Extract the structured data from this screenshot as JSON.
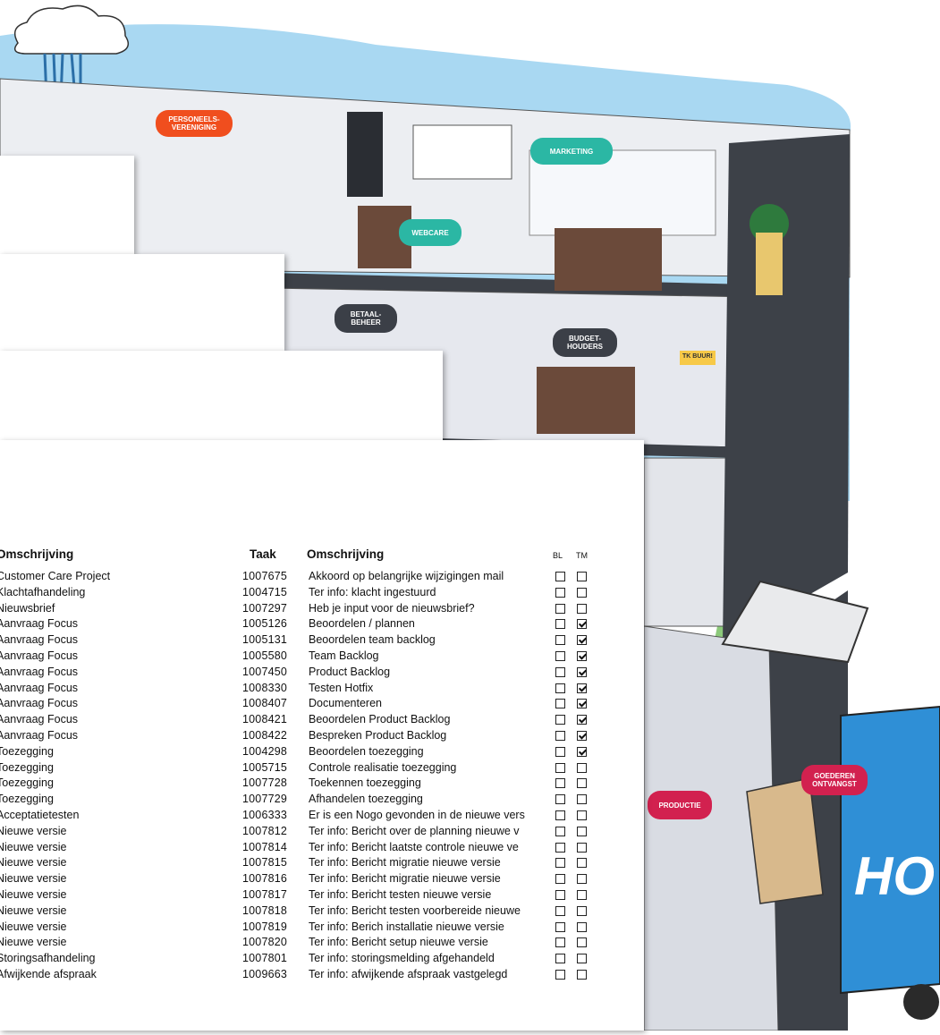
{
  "scene": {
    "labels": {
      "personeelsvereniging": "PERSONEELS-\nVERENIGING",
      "marketing": "MARKETING",
      "webcare": "WEBCARE",
      "betaalbeheer": "BETAAL-\nBEHEER",
      "budgethouders": "BUDGET-\nHOUDERS",
      "productie": "PRODUCTIE",
      "goederenontvangst": "GOEDEREN\nONTVANGST",
      "truck_text": "HO",
      "sticky_note": "TK BUUR!"
    },
    "colors": {
      "sky": "#a9d8f2",
      "wall": "#e9e9ef",
      "building_dark": "#3d4148",
      "truck": "#2f8fd6",
      "grass": "#8cc97a",
      "orange": "#f04e1e",
      "teal": "#2bb7a4",
      "red": "#d2214f"
    }
  },
  "table": {
    "headers": {
      "omschrijving_left": "Omschrijving",
      "taak": "Taak",
      "omschrijving_right": "Omschrijving",
      "bl": "BL",
      "tm": "TM"
    },
    "rows": [
      {
        "omschrijving": "Customer Care Project",
        "taak": "1007675",
        "desc": "Akkoord op belangrijke wijzigingen mail",
        "bl": false,
        "tm": false
      },
      {
        "omschrijving": "Klachtafhandeling",
        "taak": "1004715",
        "desc": "Ter info: klacht ingestuurd",
        "bl": false,
        "tm": false
      },
      {
        "omschrijving": "Nieuwsbrief",
        "taak": "1007297",
        "desc": "Heb je input voor de nieuwsbrief?",
        "bl": false,
        "tm": false
      },
      {
        "omschrijving": "Aanvraag Focus",
        "taak": "1005126",
        "desc": "Beoordelen / plannen",
        "bl": false,
        "tm": true
      },
      {
        "omschrijving": "Aanvraag Focus",
        "taak": "1005131",
        "desc": "Beoordelen team backlog",
        "bl": false,
        "tm": true
      },
      {
        "omschrijving": "Aanvraag Focus",
        "taak": "1005580",
        "desc": "Team Backlog",
        "bl": false,
        "tm": true
      },
      {
        "omschrijving": "Aanvraag Focus",
        "taak": "1007450",
        "desc": "Product Backlog",
        "bl": false,
        "tm": true
      },
      {
        "omschrijving": "Aanvraag Focus",
        "taak": "1008330",
        "desc": "Testen Hotfix",
        "bl": false,
        "tm": true
      },
      {
        "omschrijving": "Aanvraag Focus",
        "taak": "1008407",
        "desc": "Documenteren",
        "bl": false,
        "tm": true
      },
      {
        "omschrijving": "Aanvraag Focus",
        "taak": "1008421",
        "desc": "Beoordelen Product Backlog",
        "bl": false,
        "tm": true
      },
      {
        "omschrijving": "Aanvraag Focus",
        "taak": "1008422",
        "desc": "Bespreken Product Backlog",
        "bl": false,
        "tm": true
      },
      {
        "omschrijving": "Toezegging",
        "taak": "1004298",
        "desc": "Beoordelen toezegging",
        "bl": false,
        "tm": true
      },
      {
        "omschrijving": "Toezegging",
        "taak": "1005715",
        "desc": "Controle realisatie toezegging",
        "bl": false,
        "tm": false
      },
      {
        "omschrijving": "Toezegging",
        "taak": "1007728",
        "desc": "Toekennen toezegging",
        "bl": false,
        "tm": false
      },
      {
        "omschrijving": "Toezegging",
        "taak": "1007729",
        "desc": "Afhandelen toezegging",
        "bl": false,
        "tm": false
      },
      {
        "omschrijving": "Acceptatietesten",
        "taak": "1006333",
        "desc": "Er is een Nogo gevonden in de nieuwe vers",
        "bl": false,
        "tm": false
      },
      {
        "omschrijving": "Nieuwe versie",
        "taak": "1007812",
        "desc": "Ter info: Bericht over de planning nieuwe v",
        "bl": false,
        "tm": false
      },
      {
        "omschrijving": "Nieuwe versie",
        "taak": "1007814",
        "desc": "Ter info: Bericht laatste controle nieuwe ve",
        "bl": false,
        "tm": false
      },
      {
        "omschrijving": "Nieuwe versie",
        "taak": "1007815",
        "desc": "Ter info: Bericht migratie nieuwe versie",
        "bl": false,
        "tm": false
      },
      {
        "omschrijving": "Nieuwe versie",
        "taak": "1007816",
        "desc": "Ter info: Bericht migratie  nieuwe versie",
        "bl": false,
        "tm": false
      },
      {
        "omschrijving": "Nieuwe versie",
        "taak": "1007817",
        "desc": "Ter info: Bericht testen nieuwe versie",
        "bl": false,
        "tm": false
      },
      {
        "omschrijving": "Nieuwe versie",
        "taak": "1007818",
        "desc": "Ter info: Bericht testen voorbereide nieuwe",
        "bl": false,
        "tm": false
      },
      {
        "omschrijving": "Nieuwe versie",
        "taak": "1007819",
        "desc": "Ter info: Berich installatie nieuwe versie",
        "bl": false,
        "tm": false
      },
      {
        "omschrijving": "Nieuwe versie",
        "taak": "1007820",
        "desc": "Ter info: Bericht setup nieuwe versie",
        "bl": false,
        "tm": false
      },
      {
        "omschrijving": "Storingsafhandeling",
        "taak": "1007801",
        "desc": "Ter info: storingsmelding afgehandeld",
        "bl": false,
        "tm": false
      },
      {
        "omschrijving": "Afwijkende afspraak",
        "taak": "1009663",
        "desc": "Ter info: afwijkende afspraak vastgelegd",
        "bl": false,
        "tm": false
      }
    ]
  }
}
